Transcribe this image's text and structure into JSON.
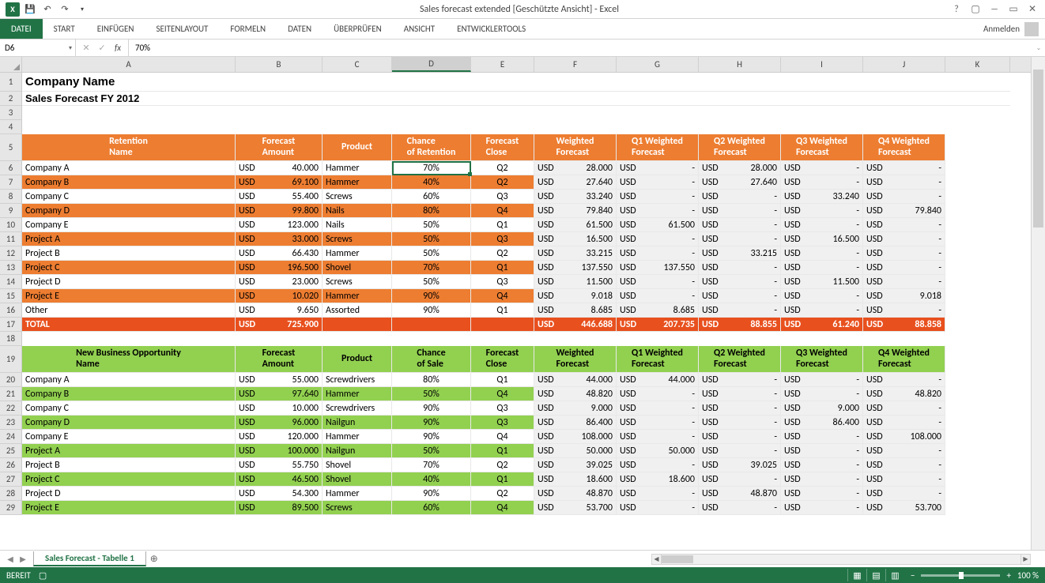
{
  "app": {
    "title": "Sales forecast extended  [Geschützte Ansicht] - Excel",
    "signin": "Anmelden"
  },
  "ribbon": {
    "file": "DATEI",
    "tabs": [
      "START",
      "EINFÜGEN",
      "SEITENLAYOUT",
      "FORMELN",
      "DATEN",
      "ÜBERPRÜFEN",
      "ANSICHT",
      "ENTWICKLERTOOLS"
    ]
  },
  "formula": {
    "name_box": "D6",
    "value": "70%"
  },
  "columns": [
    "A",
    "B",
    "C",
    "D",
    "E",
    "F",
    "G",
    "H",
    "I",
    "J",
    "K"
  ],
  "title": "Company Name",
  "subtitle": "Sales Forecast FY 2012",
  "headers1": {
    "retention": "Retention\nName",
    "forecast_amount": "Forecast\nAmount",
    "product": "Product",
    "chance": "Chance\nof Retention",
    "close": "Forecast\nClose",
    "weighted": "Weighted\nForecast",
    "q1": "Q1 Weighted\nForecast",
    "q2": "Q2 Weighted\nForecast",
    "q3": "Q3 Weighted\nForecast",
    "q4": "Q4 Weighted\nForecast"
  },
  "headers2": {
    "name": "New Business Opportunity\nName",
    "forecast_amount": "Forecast\nAmount",
    "product": "Product",
    "chance": "Chance\nof Sale",
    "close": "Forecast\nClose",
    "weighted": "Weighted\nForecast",
    "q1": "Q1 Weighted\nForecast",
    "q2": "Q2 Weighted\nForecast",
    "q3": "Q3 Weighted\nForecast",
    "q4": "Q4 Weighted\nForecast"
  },
  "retention_rows": [
    {
      "name": "Company A",
      "cur": "USD",
      "amt": "40.000",
      "prod": "Hammer",
      "chance": "70%",
      "close": "Q2",
      "wcur": "USD",
      "w": "28.000",
      "q1c": "USD",
      "q1": "-",
      "q2c": "USD",
      "q2": "28.000",
      "q3c": "USD",
      "q3": "-",
      "q4c": "USD",
      "q4": "-",
      "alt": false
    },
    {
      "name": "Company B",
      "cur": "USD",
      "amt": "69.100",
      "prod": "Hammer",
      "chance": "40%",
      "close": "Q2",
      "wcur": "USD",
      "w": "27.640",
      "q1c": "USD",
      "q1": "-",
      "q2c": "USD",
      "q2": "27.640",
      "q3c": "USD",
      "q3": "-",
      "q4c": "USD",
      "q4": "-",
      "alt": true
    },
    {
      "name": "Company C",
      "cur": "USD",
      "amt": "55.400",
      "prod": "Screws",
      "chance": "60%",
      "close": "Q3",
      "wcur": "USD",
      "w": "33.240",
      "q1c": "USD",
      "q1": "-",
      "q2c": "USD",
      "q2": "-",
      "q3c": "USD",
      "q3": "33.240",
      "q4c": "USD",
      "q4": "-",
      "alt": false
    },
    {
      "name": "Company D",
      "cur": "USD",
      "amt": "99.800",
      "prod": "Nails",
      "chance": "80%",
      "close": "Q4",
      "wcur": "USD",
      "w": "79.840",
      "q1c": "USD",
      "q1": "-",
      "q2c": "USD",
      "q2": "-",
      "q3c": "USD",
      "q3": "-",
      "q4c": "USD",
      "q4": "79.840",
      "alt": true
    },
    {
      "name": "Company E",
      "cur": "USD",
      "amt": "123.000",
      "prod": "Nails",
      "chance": "50%",
      "close": "Q1",
      "wcur": "USD",
      "w": "61.500",
      "q1c": "USD",
      "q1": "61.500",
      "q2c": "USD",
      "q2": "-",
      "q3c": "USD",
      "q3": "-",
      "q4c": "USD",
      "q4": "-",
      "alt": false
    },
    {
      "name": "Project A",
      "cur": "USD",
      "amt": "33.000",
      "prod": "Screws",
      "chance": "50%",
      "close": "Q3",
      "wcur": "USD",
      "w": "16.500",
      "q1c": "USD",
      "q1": "-",
      "q2c": "USD",
      "q2": "-",
      "q3c": "USD",
      "q3": "16.500",
      "q4c": "USD",
      "q4": "-",
      "alt": true
    },
    {
      "name": "Project B",
      "cur": "USD",
      "amt": "66.430",
      "prod": "Hammer",
      "chance": "50%",
      "close": "Q2",
      "wcur": "USD",
      "w": "33.215",
      "q1c": "USD",
      "q1": "-",
      "q2c": "USD",
      "q2": "33.215",
      "q3c": "USD",
      "q3": "-",
      "q4c": "USD",
      "q4": "-",
      "alt": false
    },
    {
      "name": "Project C",
      "cur": "USD",
      "amt": "196.500",
      "prod": "Shovel",
      "chance": "70%",
      "close": "Q1",
      "wcur": "USD",
      "w": "137.550",
      "q1c": "USD",
      "q1": "137.550",
      "q2c": "USD",
      "q2": "-",
      "q3c": "USD",
      "q3": "-",
      "q4c": "USD",
      "q4": "-",
      "alt": true
    },
    {
      "name": "Project D",
      "cur": "USD",
      "amt": "23.000",
      "prod": "Screws",
      "chance": "50%",
      "close": "Q3",
      "wcur": "USD",
      "w": "11.500",
      "q1c": "USD",
      "q1": "-",
      "q2c": "USD",
      "q2": "-",
      "q3c": "USD",
      "q3": "11.500",
      "q4c": "USD",
      "q4": "-",
      "alt": false
    },
    {
      "name": "Project E",
      "cur": "USD",
      "amt": "10.020",
      "prod": "Hammer",
      "chance": "90%",
      "close": "Q4",
      "wcur": "USD",
      "w": "9.018",
      "q1c": "USD",
      "q1": "-",
      "q2c": "USD",
      "q2": "-",
      "q3c": "USD",
      "q3": "-",
      "q4c": "USD",
      "q4": "9.018",
      "alt": true
    },
    {
      "name": "Other",
      "cur": "USD",
      "amt": "9.650",
      "prod": "Assorted",
      "chance": "90%",
      "close": "Q1",
      "wcur": "USD",
      "w": "8.685",
      "q1c": "USD",
      "q1": "8.685",
      "q2c": "USD",
      "q2": "-",
      "q3c": "USD",
      "q3": "-",
      "q4c": "USD",
      "q4": "-",
      "alt": false
    }
  ],
  "retention_total": {
    "name": "TOTAL",
    "cur": "USD",
    "amt": "725.900",
    "wcur": "USD",
    "w": "446.688",
    "q1c": "USD",
    "q1": "207.735",
    "q2c": "USD",
    "q2": "88.855",
    "q3c": "USD",
    "q3": "61.240",
    "q4c": "USD",
    "q4": "88.858"
  },
  "newbiz_rows": [
    {
      "name": "Company A",
      "cur": "USD",
      "amt": "55.000",
      "prod": "Screwdrivers",
      "chance": "80%",
      "close": "Q1",
      "wcur": "USD",
      "w": "44.000",
      "q1c": "USD",
      "q1": "44.000",
      "q2c": "USD",
      "q2": "-",
      "q3c": "USD",
      "q3": "-",
      "q4c": "USD",
      "q4": "-",
      "alt": false
    },
    {
      "name": "Company B",
      "cur": "USD",
      "amt": "97.640",
      "prod": "Hammer",
      "chance": "50%",
      "close": "Q4",
      "wcur": "USD",
      "w": "48.820",
      "q1c": "USD",
      "q1": "-",
      "q2c": "USD",
      "q2": "-",
      "q3c": "USD",
      "q3": "-",
      "q4c": "USD",
      "q4": "48.820",
      "alt": true
    },
    {
      "name": "Company C",
      "cur": "USD",
      "amt": "10.000",
      "prod": "Screwdrivers",
      "chance": "90%",
      "close": "Q3",
      "wcur": "USD",
      "w": "9.000",
      "q1c": "USD",
      "q1": "-",
      "q2c": "USD",
      "q2": "-",
      "q3c": "USD",
      "q3": "9.000",
      "q4c": "USD",
      "q4": "-",
      "alt": false
    },
    {
      "name": "Company D",
      "cur": "USD",
      "amt": "96.000",
      "prod": "Nailgun",
      "chance": "90%",
      "close": "Q3",
      "wcur": "USD",
      "w": "86.400",
      "q1c": "USD",
      "q1": "-",
      "q2c": "USD",
      "q2": "-",
      "q3c": "USD",
      "q3": "86.400",
      "q4c": "USD",
      "q4": "-",
      "alt": true
    },
    {
      "name": "Company E",
      "cur": "USD",
      "amt": "120.000",
      "prod": "Hammer",
      "chance": "90%",
      "close": "Q4",
      "wcur": "USD",
      "w": "108.000",
      "q1c": "USD",
      "q1": "-",
      "q2c": "USD",
      "q2": "-",
      "q3c": "USD",
      "q3": "-",
      "q4c": "USD",
      "q4": "108.000",
      "alt": false
    },
    {
      "name": "Project A",
      "cur": "USD",
      "amt": "100.000",
      "prod": "Nailgun",
      "chance": "50%",
      "close": "Q1",
      "wcur": "USD",
      "w": "50.000",
      "q1c": "USD",
      "q1": "50.000",
      "q2c": "USD",
      "q2": "-",
      "q3c": "USD",
      "q3": "-",
      "q4c": "USD",
      "q4": "-",
      "alt": true
    },
    {
      "name": "Project B",
      "cur": "USD",
      "amt": "55.750",
      "prod": "Shovel",
      "chance": "70%",
      "close": "Q2",
      "wcur": "USD",
      "w": "39.025",
      "q1c": "USD",
      "q1": "-",
      "q2c": "USD",
      "q2": "39.025",
      "q3c": "USD",
      "q3": "-",
      "q4c": "USD",
      "q4": "-",
      "alt": false
    },
    {
      "name": "Project C",
      "cur": "USD",
      "amt": "46.500",
      "prod": "Shovel",
      "chance": "40%",
      "close": "Q1",
      "wcur": "USD",
      "w": "18.600",
      "q1c": "USD",
      "q1": "18.600",
      "q2c": "USD",
      "q2": "-",
      "q3c": "USD",
      "q3": "-",
      "q4c": "USD",
      "q4": "-",
      "alt": true
    },
    {
      "name": "Project D",
      "cur": "USD",
      "amt": "54.300",
      "prod": "Hammer",
      "chance": "90%",
      "close": "Q2",
      "wcur": "USD",
      "w": "48.870",
      "q1c": "USD",
      "q1": "-",
      "q2c": "USD",
      "q2": "48.870",
      "q3c": "USD",
      "q3": "-",
      "q4c": "USD",
      "q4": "-",
      "alt": false
    },
    {
      "name": "Project E",
      "cur": "USD",
      "amt": "89.500",
      "prod": "Screws",
      "chance": "60%",
      "close": "Q4",
      "wcur": "USD",
      "w": "53.700",
      "q1c": "USD",
      "q1": "-",
      "q2c": "USD",
      "q2": "-",
      "q3c": "USD",
      "q3": "-",
      "q4c": "USD",
      "q4": "53.700",
      "alt": true
    }
  ],
  "sheet": {
    "active": "Sales Forecast - Tabelle 1"
  },
  "status": {
    "ready": "BEREIT",
    "zoom": "100 %"
  }
}
